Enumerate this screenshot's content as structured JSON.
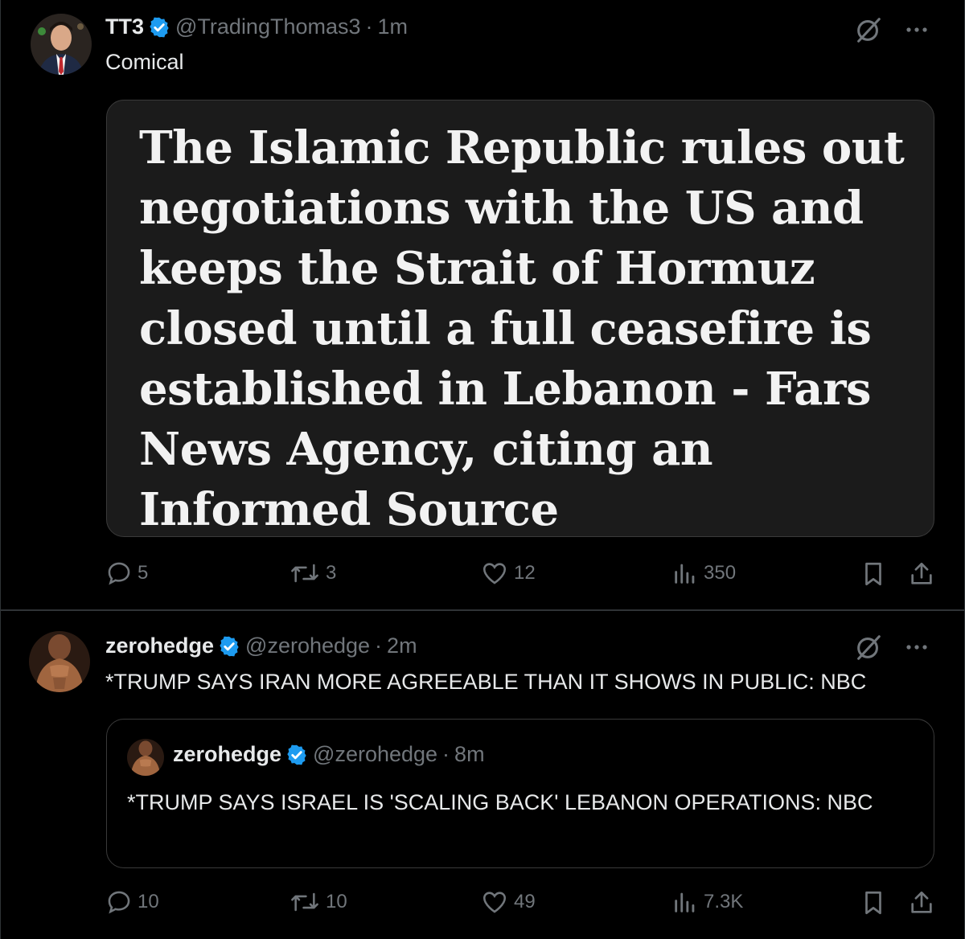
{
  "tweets": [
    {
      "display_name": "TT3",
      "handle": "@TradingThomas3",
      "time": "1m",
      "text": "Comical",
      "card_headline": "The Islamic Republic rules out negotiations with the US and keeps the Strait of Hormuz closed until a full ceasefire is established in Lebanon - Fars News Agency, citing an Informed Source",
      "stats": {
        "replies": "5",
        "reposts": "3",
        "likes": "12",
        "views": "350"
      }
    },
    {
      "display_name": "zerohedge",
      "handle": "@zerohedge",
      "time": "2m",
      "text": "*TRUMP SAYS IRAN MORE AGREEABLE THAN IT SHOWS IN PUBLIC: NBC",
      "quote": {
        "display_name": "zerohedge",
        "handle": "@zerohedge",
        "time": "8m",
        "text": "*TRUMP SAYS ISRAEL IS 'SCALING BACK' LEBANON OPERATIONS: NBC"
      },
      "stats": {
        "replies": "10",
        "reposts": "10",
        "likes": "49",
        "views": "7.3K"
      }
    }
  ],
  "separator": "·",
  "colors": {
    "background": "#000000",
    "text": "#e7e9ea",
    "muted": "#71767b",
    "verified": "#1d9bf0",
    "border": "#2f3336"
  },
  "icons": [
    "verified-badge-icon",
    "grok-icon",
    "more-icon",
    "reply-icon",
    "repost-icon",
    "like-icon",
    "views-icon",
    "bookmark-icon",
    "share-icon"
  ]
}
